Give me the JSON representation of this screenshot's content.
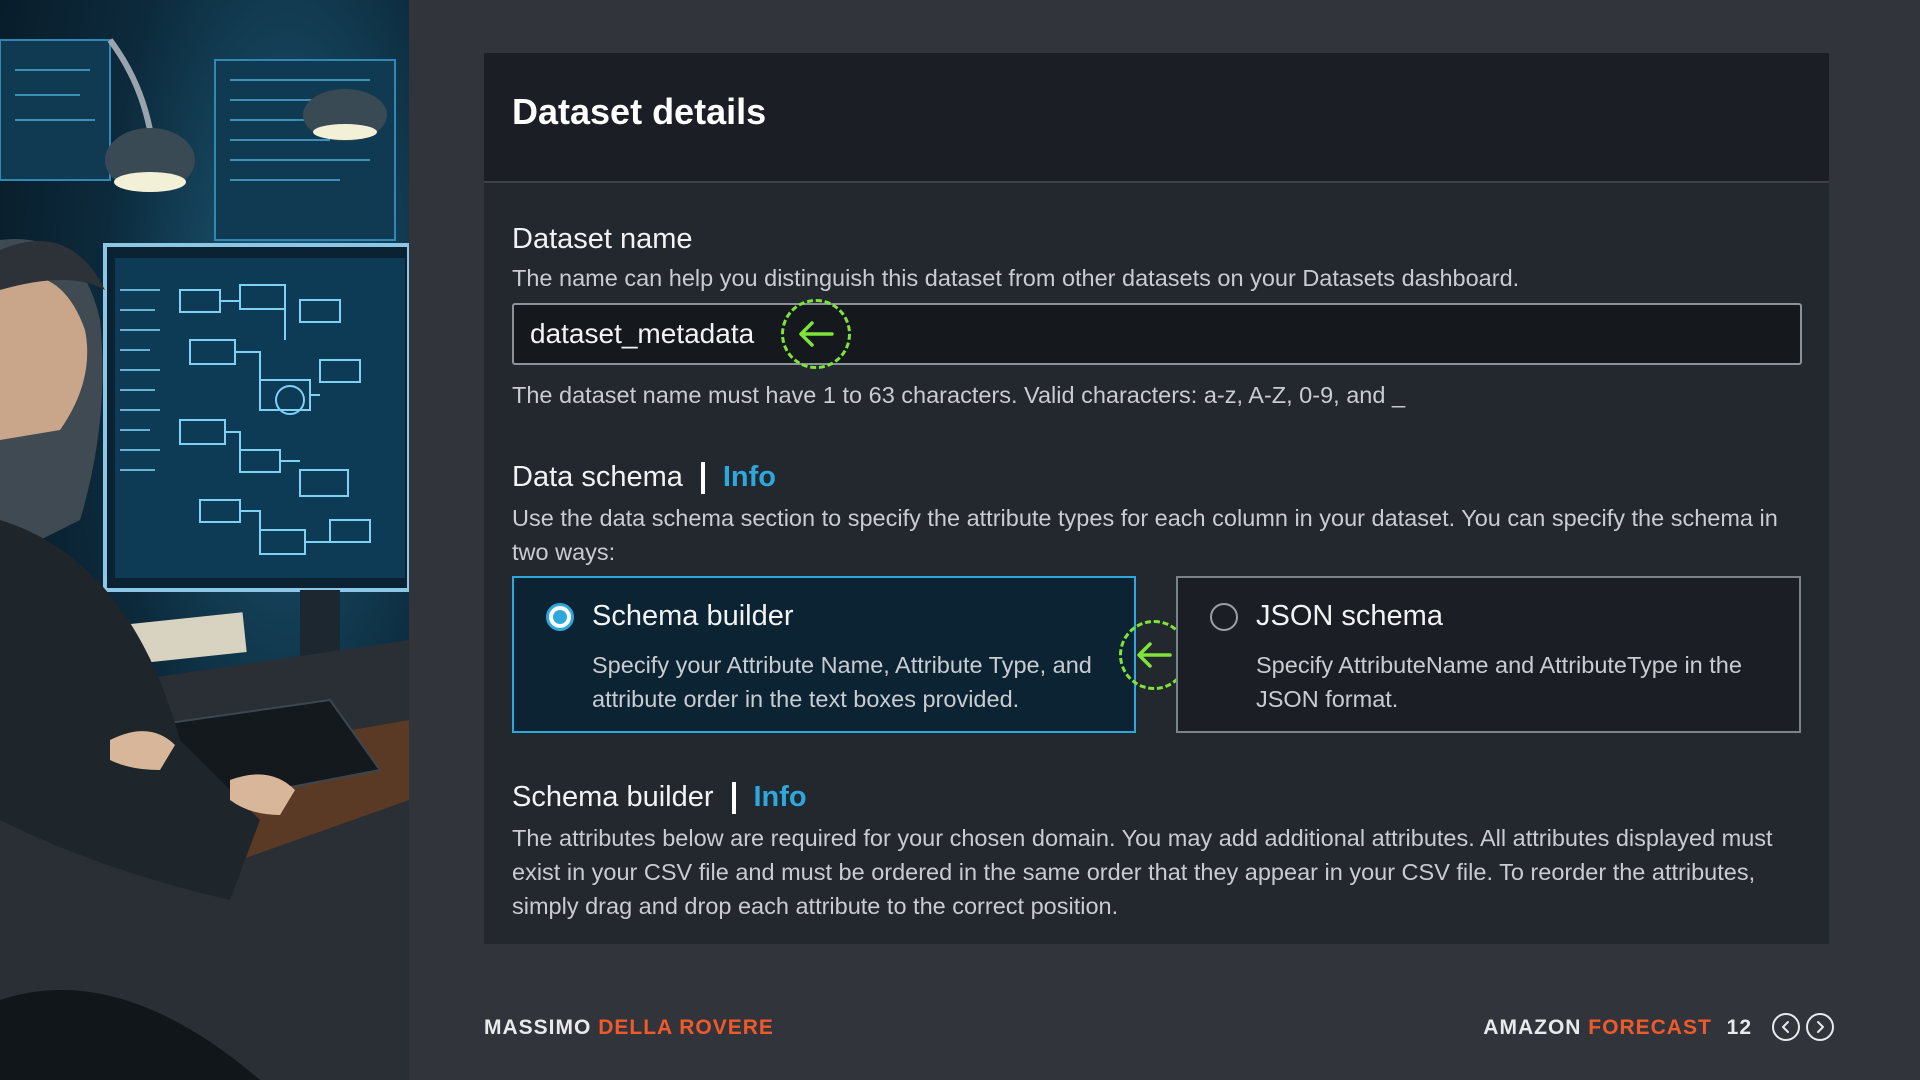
{
  "panel": {
    "title": "Dataset details"
  },
  "dataset_name": {
    "label": "Dataset name",
    "description": "The name can help you distinguish this dataset from other datasets on your Datasets dashboard.",
    "value": "dataset_metadata",
    "constraint": "The dataset name must have 1 to 63 characters. Valid characters: a-z, A-Z, 0-9, and _"
  },
  "data_schema": {
    "label": "Data schema",
    "info": "Info",
    "description": "Use the data schema section to specify the attribute types for each column in your dataset. You can specify the schema in two ways:",
    "options": [
      {
        "title": "Schema builder",
        "description": "Specify your Attribute Name, Attribute Type, and attribute order in the text boxes provided.",
        "selected": true
      },
      {
        "title": "JSON schema",
        "description": "Specify AttributeName and AttributeType in the JSON format.",
        "selected": false
      }
    ]
  },
  "schema_builder": {
    "label": "Schema builder",
    "info": "Info",
    "description": "The attributes below are required for your chosen domain. You may add additional attributes. All attributes displayed must exist in your CSV file and must be ordered in the same order that they appear in your CSV file. To reorder the attributes, simply drag and drop each attribute to the correct position."
  },
  "footer": {
    "author_first": "MASSIMO",
    "author_last": "DELLA ROVERE",
    "brand_first": "AMAZON",
    "brand_second": "FORECAST",
    "page_number": "12"
  },
  "colors": {
    "background": "#31353b",
    "panel": "#23272e",
    "accent_blue": "#2ea8dc",
    "accent_orange": "#ef5a2a",
    "highlight_green": "#7fe33a"
  },
  "icons": {
    "annotation": "arrow-left-icon",
    "nav_prev": "chevron-left-icon",
    "nav_next": "chevron-right-icon"
  }
}
